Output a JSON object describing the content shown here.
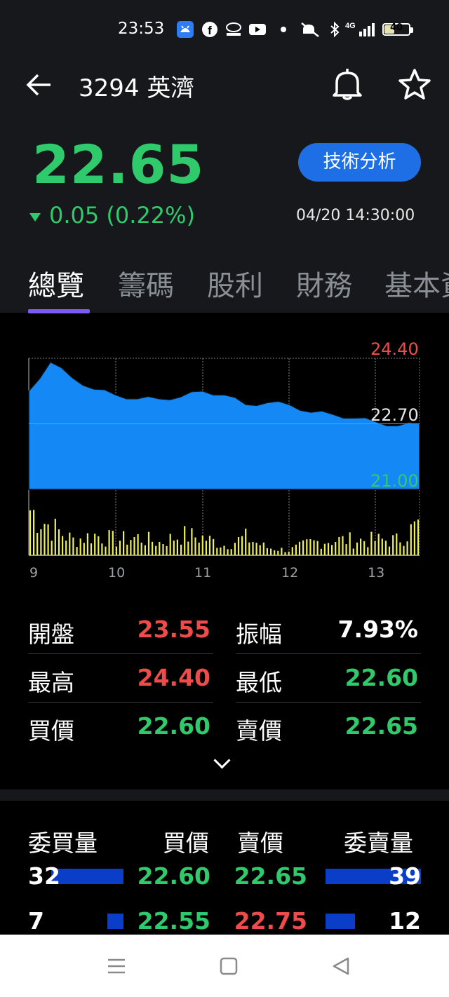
{
  "status_bar": {
    "time": "23:53",
    "battery": "40",
    "icons": [
      "app-icon",
      "facebook-icon",
      "somaji-icon",
      "youtube-icon",
      "dot-icon",
      "mute-icon",
      "bluetooth-icon",
      "signal-4g-icon",
      "battery-icon"
    ]
  },
  "header": {
    "title": "3294 英濟",
    "back_icon": "back-arrow-icon",
    "bell_icon": "bell-icon",
    "star_icon": "star-icon"
  },
  "quote": {
    "price": "22.65",
    "change": "0.05 (0.22%)",
    "direction": "down",
    "timestamp": "04/20 14:30:00",
    "tech_button": "技術分析",
    "colors": {
      "up": "#ef4b4b",
      "down": "#2fca6b",
      "accent": "#1e6ee6"
    }
  },
  "tabs": [
    "總覽",
    "籌碼",
    "股利",
    "財務",
    "基本資"
  ],
  "chart_data": {
    "type": "area",
    "x_ticks": [
      "9",
      "10",
      "11",
      "12",
      "13"
    ],
    "y_labels": {
      "high": "24.40",
      "mid": "22.70",
      "low": "21.00"
    },
    "ylim": [
      21.0,
      24.4
    ],
    "reference": 22.7,
    "x": [
      "9:00",
      "9:15",
      "9:30",
      "9:45",
      "10:00",
      "10:15",
      "10:30",
      "10:45",
      "11:00",
      "11:15",
      "11:30",
      "11:45",
      "12:00",
      "12:15",
      "12:30",
      "12:45",
      "13:00",
      "13:15",
      "13:30"
    ],
    "price": [
      23.55,
      24.3,
      23.9,
      23.6,
      23.45,
      23.35,
      23.35,
      23.4,
      23.55,
      23.45,
      23.2,
      23.25,
      23.2,
      23.0,
      22.95,
      22.85,
      22.75,
      22.65,
      22.7
    ],
    "volume_relative": [
      0.9,
      0.55,
      0.3,
      0.4,
      0.3,
      0.35,
      0.25,
      0.4,
      0.35,
      0.2,
      0.35,
      0.15,
      0.1,
      0.25,
      0.3,
      0.3,
      0.3,
      0.3,
      0.6
    ]
  },
  "stats": [
    {
      "label": "開盤",
      "value": "23.55",
      "color": "#ef4b4b"
    },
    {
      "label": "振幅",
      "value": "7.93%",
      "color": "#ffffff"
    },
    {
      "label": "最高",
      "value": "24.40",
      "color": "#ef4b4b"
    },
    {
      "label": "最低",
      "value": "22.60",
      "color": "#2fca6b"
    },
    {
      "label": "買價",
      "value": "22.60",
      "color": "#2fca6b"
    },
    {
      "label": "賣價",
      "value": "22.65",
      "color": "#2fca6b"
    }
  ],
  "order_book": {
    "headers": [
      "委買量",
      "買價",
      "賣價",
      "委賣量"
    ],
    "rows": [
      {
        "bid_vol": "32",
        "bid": "22.60",
        "ask": "22.65",
        "ask_vol": "39",
        "bid_fill": 0.82,
        "ask_fill": 1.0
      },
      {
        "bid_vol": "7",
        "bid": "22.55",
        "ask": "22.75",
        "ask_vol": "12",
        "bid_fill": 0.18,
        "ask_fill": 0.31
      }
    ]
  },
  "nav": [
    "menu-icon",
    "home-icon",
    "back-triangle-icon"
  ]
}
